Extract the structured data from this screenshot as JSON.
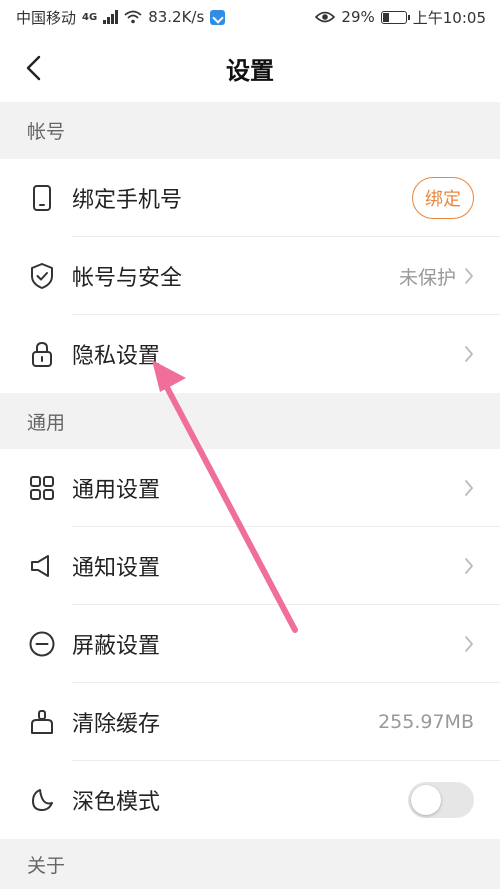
{
  "status_bar": {
    "carrier": "中国移动",
    "network": "4G",
    "speed": "83.2K/s",
    "battery": "29%",
    "battery_level": 0.29,
    "time": "上午10:05"
  },
  "nav": {
    "title": "设置",
    "back_icon": "chevron-left-icon"
  },
  "sections": [
    {
      "header": "帐号",
      "rows": [
        {
          "label": "绑定手机号",
          "icon": "phone-icon",
          "action_label": "绑定"
        },
        {
          "label": "帐号与安全",
          "icon": "shield-icon",
          "value": "未保护"
        },
        {
          "label": "隐私设置",
          "icon": "lock-icon"
        }
      ]
    },
    {
      "header": "通用",
      "rows": [
        {
          "label": "通用设置",
          "icon": "grid-icon"
        },
        {
          "label": "通知设置",
          "icon": "speaker-icon"
        },
        {
          "label": "屏蔽设置",
          "icon": "minus-circle-icon"
        },
        {
          "label": "清除缓存",
          "icon": "broom-icon",
          "value": "255.97MB"
        },
        {
          "label": "深色模式",
          "icon": "moon-icon",
          "toggle_on": false
        }
      ]
    },
    {
      "header": "关于",
      "rows": []
    }
  ],
  "colors": {
    "accent": "#e8873f",
    "annotation_arrow": "#ef6e9a"
  }
}
